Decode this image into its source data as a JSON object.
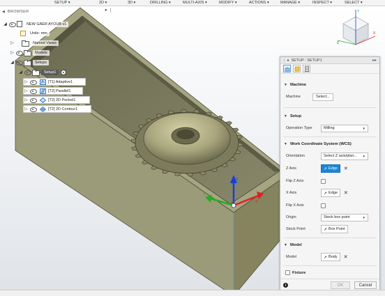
{
  "toolbar": {
    "items": [
      "SETUP",
      "2D",
      "3D",
      "DRILLING",
      "MULTI-AXIS",
      "MODIFY",
      "ACTIONS",
      "MANAGE",
      "INSPECT",
      "SELECT"
    ]
  },
  "browser": {
    "title": "BROWSER",
    "document_name": "NEW GAER AYOUB v1",
    "units": "Units: mm",
    "named_views": "Named Views",
    "models": "Models",
    "setups": "Setups",
    "setup_item": "Setup1",
    "operations": [
      {
        "label": "[T1] Adaptive1",
        "icon": "adaptive-icon"
      },
      {
        "label": "[T2] Parallel1",
        "icon": "parallel-icon"
      },
      {
        "label": "[T2] 2D Pocket1",
        "icon": "pocket-icon"
      },
      {
        "label": "[T2] 2D Contour1",
        "icon": "contour-icon"
      }
    ]
  },
  "viewcube": {
    "x_label": "X",
    "y_label": "Y",
    "z_label": "Z"
  },
  "panel": {
    "title": "SETUP : SETUP1",
    "sections": {
      "machine": "Machine",
      "setup": "Setup",
      "wcs": "Work Coordinate System (WCS)",
      "model": "Model",
      "fixture": "Fixture"
    },
    "fields": {
      "machine_label": "Machine",
      "machine_button": "Select...",
      "operation_type_label": "Operation Type",
      "operation_type_value": "Milling",
      "orientation_label": "Orientation",
      "orientation_value": "Select Z axis/plan...",
      "z_axis_label": "Z Axis",
      "z_axis_value": "Edge",
      "flip_z_label": "Flip Z Axis",
      "x_axis_label": "X Axis",
      "x_axis_value": "Edge",
      "flip_x_label": "Flip X Axis",
      "origin_label": "Origin",
      "origin_value": "Stock box point",
      "stock_point_label": "Stock Point",
      "stock_point_value": "Box Point",
      "model_label": "Model",
      "model_value": "Body"
    },
    "footer": {
      "ok": "OK",
      "cancel": "Cancel"
    }
  },
  "colors": {
    "accent": "#1b86d6",
    "part_top": "#8d8c6a",
    "part_side": "#9a9977",
    "axis_x": "#e02020",
    "axis_y": "#20b020",
    "axis_z": "#1a3fd6"
  }
}
